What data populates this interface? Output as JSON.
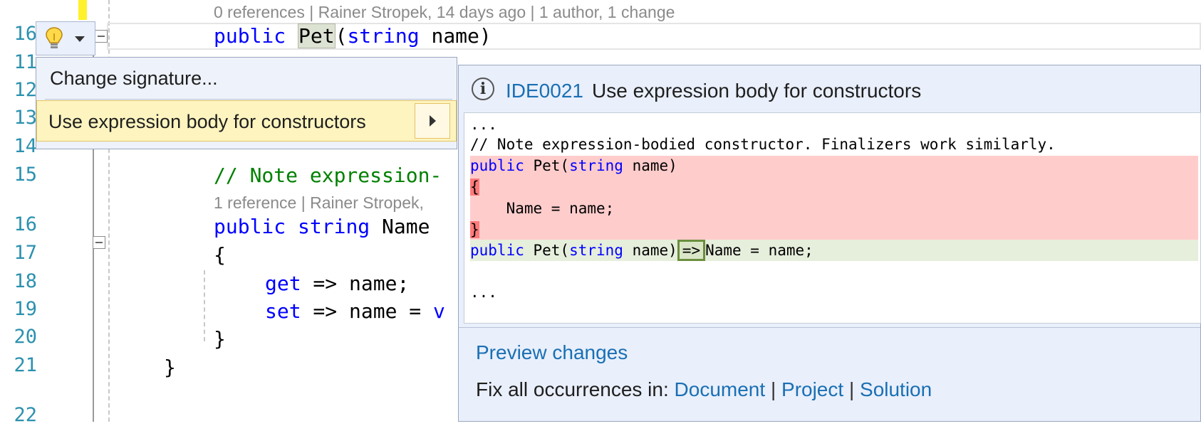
{
  "editor": {
    "lens_top": "0 references | Rainer Stropek, 14 days ago | 1 author, 1 change",
    "lens_mid": "1 reference | Rainer Stropek,",
    "line_numbers": [
      "16",
      "11",
      "12",
      "13",
      "14",
      "15",
      "16",
      "17",
      "18",
      "19",
      "20",
      "21",
      "22"
    ],
    "line_constructor": {
      "kw": "public",
      "name": "Pet",
      "open": "(",
      "type": "string",
      "rest": " name)"
    },
    "line_comment": "// Note expression-",
    "line_property": {
      "kw1": "public",
      "kw2": "string",
      "rest": " Name"
    },
    "brace_open": "{",
    "getter": {
      "kw": "get",
      "rest": " => name;"
    },
    "setter": {
      "kw": "set",
      "rest": " => name = ",
      "tail": "v"
    },
    "brace_close_inner": "}",
    "brace_close_outer": "}"
  },
  "quick_actions": {
    "items": [
      "Change signature...",
      "Use expression body for constructors"
    ],
    "selected_index": 1
  },
  "preview": {
    "diagnostic_id": "IDE0021",
    "diagnostic_title": "Use expression body for constructors",
    "code": {
      "ellipsis_top": "...",
      "comment": "// Note expression-bodied constructor. Finalizers work similarly.",
      "removed_sig": {
        "kw": "public",
        "mid": " Pet(",
        "type": "string",
        "rest": " name)"
      },
      "removed_open": "{",
      "removed_body": "    Name = name;",
      "removed_close": "}",
      "added": {
        "kw": "public",
        "mid": " Pet(",
        "type": "string",
        "rest": " name)",
        "arrow": "=>",
        "tail": "Name = name;"
      },
      "ellipsis_bottom": "..."
    },
    "preview_link": "Preview changes",
    "fix_all_label": "Fix all occurrences in: ",
    "fix_all_scopes": [
      "Document",
      "Project",
      "Solution"
    ],
    "separator": "|"
  },
  "colors": {
    "keyword": "#0000ff",
    "comment": "#008000",
    "link": "#1a6fb4",
    "line_number": "#2b91af",
    "removed_bg": "#ffcccc",
    "added_bg": "#e6eedc"
  }
}
